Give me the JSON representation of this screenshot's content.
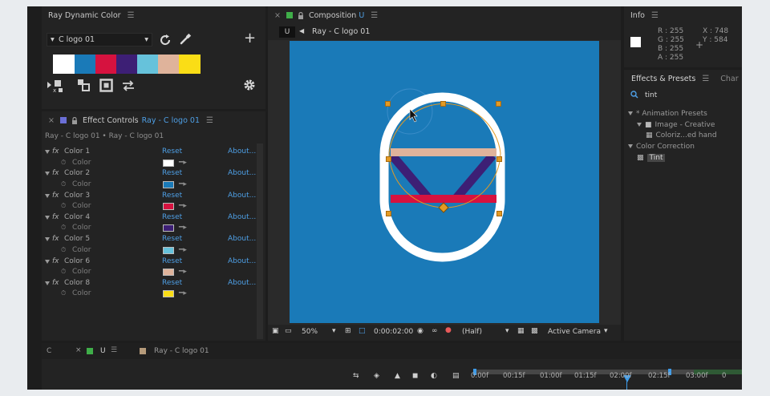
{
  "color_panel": {
    "title": "Ray Dynamic Color",
    "preset": "C logo 01",
    "swatches": [
      "#ffffff",
      "#1a7ab8",
      "#d6123f",
      "#3d1f75",
      "#66c2db",
      "#dfb39b",
      "#fadd16"
    ],
    "icons": [
      "refresh-icon",
      "eyedropper-icon",
      "plus-icon",
      "apply-icon",
      "combine-icon",
      "stroke-icon",
      "swap-icon",
      "gear-icon"
    ]
  },
  "effect_controls": {
    "title_prefix": "Effect Controls",
    "title_target": "Ray - C logo 01",
    "breadcrumb": "Ray - C logo 01 • Ray - C logo 01",
    "reset_label": "Reset",
    "about_label": "About...",
    "sub_label": "Color",
    "items": [
      {
        "name": "Color 1",
        "color": "#ffffff"
      },
      {
        "name": "Color 2",
        "color": "#1a7ab8"
      },
      {
        "name": "Color 3",
        "color": "#d6123f"
      },
      {
        "name": "Color 4",
        "color": "#3d1f75"
      },
      {
        "name": "Color 5",
        "color": "#66c2db"
      },
      {
        "name": "Color 6",
        "color": "#dfb39b"
      },
      {
        "name": "Color 8",
        "color": "#fadd16"
      }
    ]
  },
  "composition": {
    "title": "Composition",
    "title_suffix": "U",
    "tab_badge": "U",
    "breadcrumb": "Ray - C logo 01",
    "canvas_color": "#1a7ab8",
    "footer": {
      "zoom": "50%",
      "timecode": "0:00:02:00",
      "resolution": "(Half)",
      "camera": "Active Camera"
    }
  },
  "info_panel": {
    "title": "Info",
    "r": "R : 255",
    "g": "G : 255",
    "b": "B : 255",
    "a": "A : 255",
    "x": "X : 748",
    "y": "Y : 584"
  },
  "effects_presets": {
    "tab1": "Effects & Presets",
    "tab2": "Char",
    "search": "tint",
    "tree": [
      {
        "label": "* Animation Presets",
        "level": 0,
        "kind": "folder-open"
      },
      {
        "label": "Image - Creative",
        "level": 1,
        "kind": "folder"
      },
      {
        "label": "Coloriz...ed hand",
        "level": 2,
        "kind": "preset"
      },
      {
        "label": "Color Correction",
        "level": 0,
        "kind": "folder-open"
      },
      {
        "label": "Tint",
        "level": 1,
        "kind": "effect"
      }
    ]
  },
  "timeline": {
    "tabs": [
      {
        "label": "C"
      },
      {
        "label": "U"
      },
      {
        "label": "Ray - C logo 01"
      }
    ],
    "ticks": [
      "0:00f",
      "00:15f",
      "01:00f",
      "01:15f",
      "02:00f",
      "02:15f",
      "03:00f",
      "0"
    ]
  }
}
